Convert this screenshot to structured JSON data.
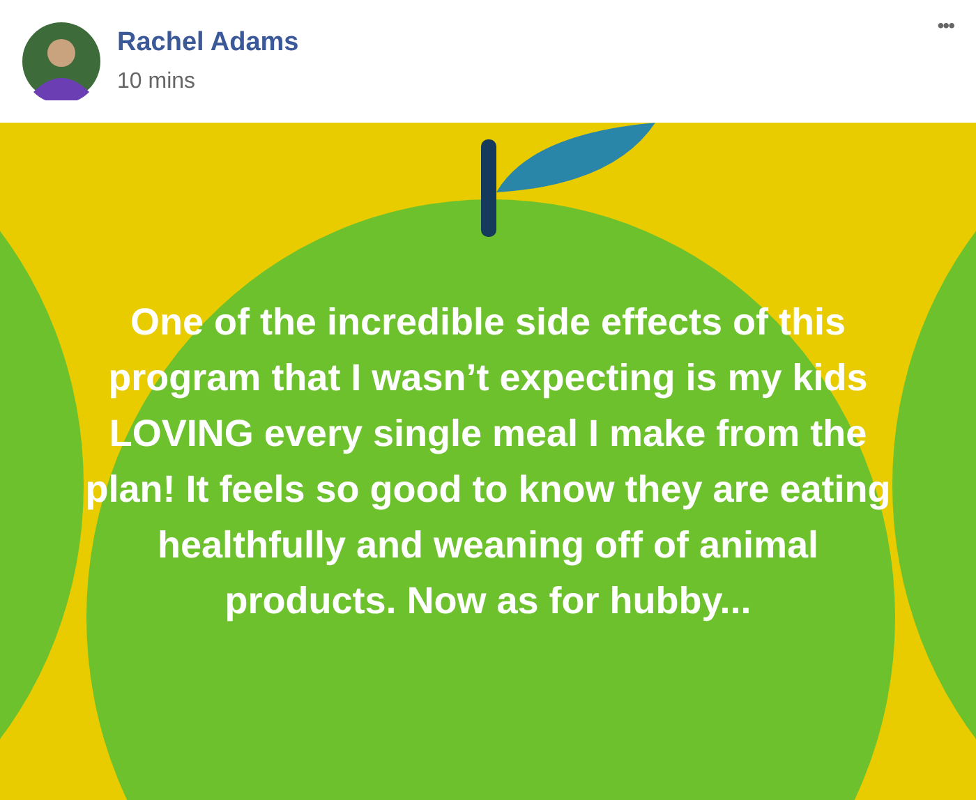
{
  "post": {
    "author": "Rachel Adams",
    "time": "10 mins",
    "menu": "•••",
    "text": "One of the incredible side effects of this program that I wasn’t expecting is my kids LOVING every single meal I make from the plan! It feels so good to know they are eating healthfully and weaning off of animal products. Now as for hubby..."
  }
}
